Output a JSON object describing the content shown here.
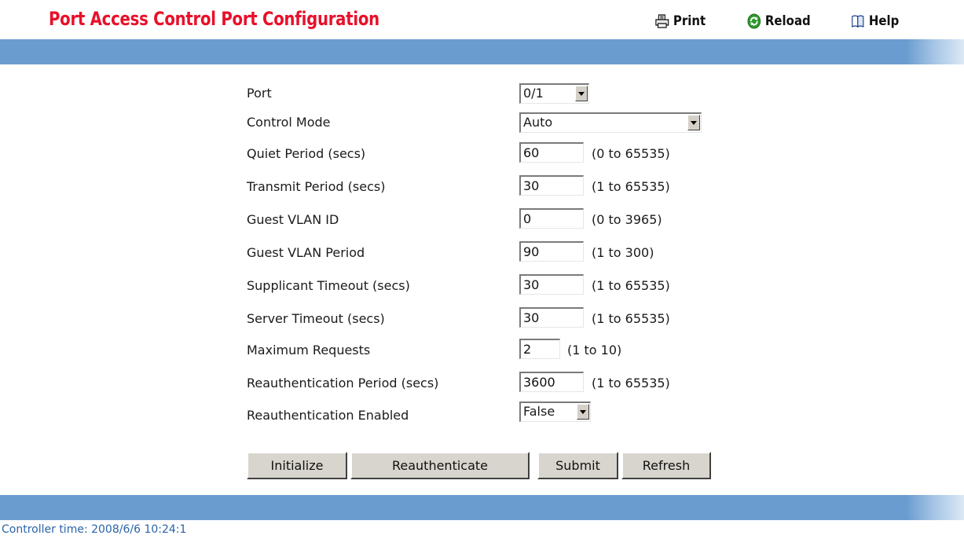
{
  "header": {
    "title": "Port Access Control Port Configuration",
    "print_label": "Print",
    "reload_label": "Reload",
    "help_label": "Help"
  },
  "form": {
    "port": {
      "label": "Port",
      "value": "0/1"
    },
    "control_mode": {
      "label": "Control Mode",
      "value": "Auto"
    },
    "quiet_period": {
      "label": "Quiet Period (secs)",
      "value": "60",
      "range": "(0 to 65535)"
    },
    "transmit_period": {
      "label": "Transmit Period (secs)",
      "value": "30",
      "range": "(1 to 65535)"
    },
    "guest_vlan_id": {
      "label": "Guest VLAN ID",
      "value": "0",
      "range": "(0 to 3965)"
    },
    "guest_vlan_period": {
      "label": "Guest VLAN Period",
      "value": "90",
      "range": "(1 to 300)"
    },
    "supplicant_timeout": {
      "label": "Supplicant Timeout (secs)",
      "value": "30",
      "range": "(1 to 65535)"
    },
    "server_timeout": {
      "label": "Server Timeout (secs)",
      "value": "30",
      "range": "(1 to 65535)"
    },
    "maximum_requests": {
      "label": "Maximum Requests",
      "value": "2",
      "range": "(1 to 10)"
    },
    "reauth_period": {
      "label": "Reauthentication Period (secs)",
      "value": "3600",
      "range": "(1 to 65535)"
    },
    "reauth_enabled": {
      "label": "Reauthentication Enabled",
      "value": "False"
    }
  },
  "buttons": {
    "initialize": "Initialize",
    "reauthenticate": "Reauthenticate",
    "submit": "Submit",
    "refresh": "Refresh"
  },
  "footer": {
    "controller_time": "Controller time: 2008/6/6 10:24:1"
  },
  "colors": {
    "title": "#e8102a",
    "bar": "#6b9ccf",
    "footer_text": "#2a64a8"
  }
}
